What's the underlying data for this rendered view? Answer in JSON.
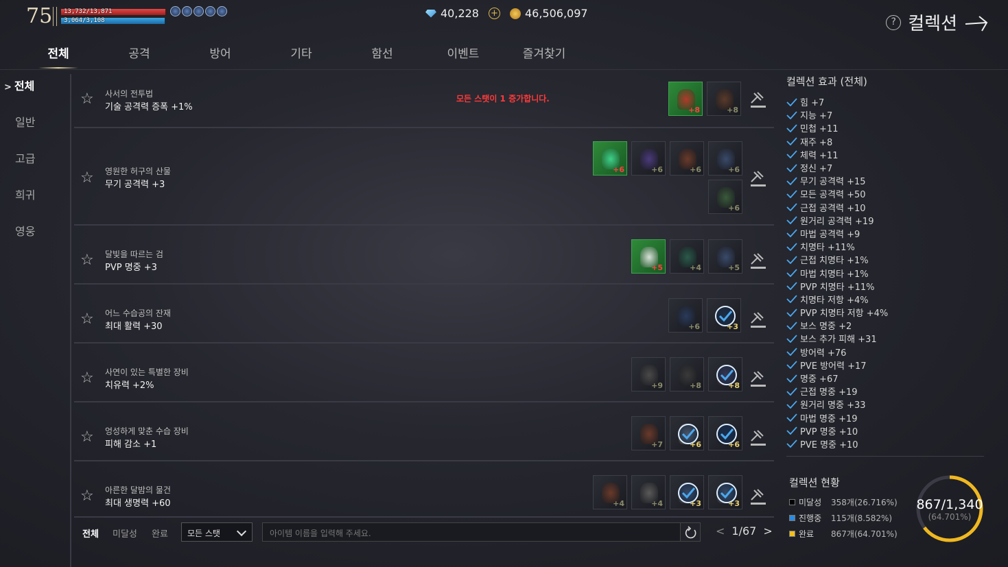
{
  "hud": {
    "level": "75",
    "hp": "13,732/13,871",
    "mp": "3,064/3,108",
    "diamonds": "40,228",
    "gold": "46,506,097"
  },
  "header": {
    "title": "컬렉션",
    "help": "?"
  },
  "tabs": [
    "전체",
    "공격",
    "방어",
    "기타",
    "함선",
    "이벤트",
    "즐겨찾기"
  ],
  "sidebar": {
    "chevron": ">",
    "items": [
      "전체",
      "일반",
      "고급",
      "희귀",
      "영웅"
    ]
  },
  "notice": "모든 스탯이 1 증가합니다.",
  "collections": [
    {
      "name": "사서의 전투법",
      "effect": "기술 공격력 증폭 +1%",
      "items": [
        {
          "enh": "+8",
          "owned": true,
          "color": "#b03a2a",
          "check": false
        },
        {
          "enh": "+8",
          "owned": false,
          "color": "#5a3a2a",
          "check": false
        }
      ]
    },
    {
      "name": "영원한 허구의 산물",
      "effect": "무기 공격력 +3",
      "items": [
        {
          "enh": "+6",
          "owned": true,
          "color": "#3fd08a",
          "check": false
        },
        {
          "enh": "+6",
          "owned": false,
          "color": "#4a3a7a",
          "check": false
        },
        {
          "enh": "+6",
          "owned": false,
          "color": "#6a3a2a",
          "check": false
        },
        {
          "enh": "+6",
          "owned": false,
          "color": "#3a4a6a",
          "check": false
        },
        {
          "enh": "+6",
          "owned": false,
          "color": "#3a5a3a",
          "check": false
        }
      ]
    },
    {
      "name": "달빛을 따르는 검",
      "effect": "PVP 명중 +3",
      "items": [
        {
          "enh": "+5",
          "owned": true,
          "color": "#d8e0d8",
          "check": false
        },
        {
          "enh": "+4",
          "owned": false,
          "color": "#2a5a4a",
          "check": false
        },
        {
          "enh": "+5",
          "owned": false,
          "color": "#3a4a6a",
          "check": false
        }
      ]
    },
    {
      "name": "어느 수습공의 잔재",
      "effect": "최대 활력 +30",
      "items": [
        {
          "enh": "+6",
          "owned": false,
          "color": "#2a3a5a",
          "check": false
        },
        {
          "enh": "+3",
          "owned": false,
          "color": "#3a3a3a",
          "check": true
        }
      ]
    },
    {
      "name": "사연이 있는 특별한 장비",
      "effect": "치유력 +2%",
      "items": [
        {
          "enh": "+9",
          "owned": false,
          "color": "#4a4a4a",
          "check": false
        },
        {
          "enh": "+8",
          "owned": false,
          "color": "#3a3a3a",
          "check": false
        },
        {
          "enh": "+8",
          "owned": false,
          "color": "#8a5a6a",
          "check": true
        }
      ]
    },
    {
      "name": "엉성하게 맞춘 수습 장비",
      "effect": "피해 감소 +1",
      "items": [
        {
          "enh": "+7",
          "owned": false,
          "color": "#6a3a2a",
          "check": false
        },
        {
          "enh": "+6",
          "owned": false,
          "color": "#c8c0b0",
          "check": true
        },
        {
          "enh": "+6",
          "owned": false,
          "color": "#2a3a5a",
          "check": true
        }
      ]
    },
    {
      "name": "아른한 달밤의 물건",
      "effect": "최대 생명력 +60",
      "items": [
        {
          "enh": "+4",
          "owned": false,
          "color": "#6a3a2a",
          "check": false
        },
        {
          "enh": "+4",
          "owned": false,
          "color": "#5a5a5a",
          "check": false
        },
        {
          "enh": "+3",
          "owned": false,
          "color": "#8a9ab0",
          "check": true
        },
        {
          "enh": "+3",
          "owned": false,
          "color": "#8a9ab0",
          "check": true
        }
      ]
    }
  ],
  "bottom": {
    "filters": [
      "전체",
      "미달성",
      "완료"
    ],
    "select": "모든 스탯",
    "search_placeholder": "아이템 이름을 입력해 주세요.",
    "page": "1/67",
    "prev": "<",
    "next": ">"
  },
  "effects": {
    "title": "컬렉션 효과 (전체)",
    "stats": [
      "힘 +7",
      "지능 +7",
      "민첩 +11",
      "재주 +8",
      "체력 +11",
      "정신 +7",
      "무기 공격력 +15",
      "모든 공격력 +50",
      "근접 공격력 +10",
      "원거리 공격력 +19",
      "마법 공격력 +9",
      "치명타 +11%",
      "근접 치명타 +1%",
      "마법 치명타 +1%",
      "PVP 치명타 +11%",
      "치명타 저항 +4%",
      "PVP 치명타 저항 +4%",
      "보스 명중 +2",
      "보스 추가 피해 +31",
      "방어력 +76",
      "PVE 방어력 +17",
      "명중 +67",
      "근접 명중 +19",
      "원거리 명중 +33",
      "마법 명중 +19",
      "PVP 명중 +10",
      "PVE 명중 +10"
    ]
  },
  "status": {
    "title": "컬렉션 현황",
    "rows": [
      {
        "label": "미달성",
        "value": "358개(26.716%)",
        "color": "#000000"
      },
      {
        "label": "진행중",
        "value": "115개(8.582%)",
        "color": "#2a8ae0"
      },
      {
        "label": "완료",
        "value": "867개(64.701%)",
        "color": "#f0c020"
      }
    ],
    "total": "867/1,340",
    "percent": "(64.701%)",
    "fraction": 0.64701,
    "accent": "#f0b820"
  },
  "colors": {
    "check": "#4aa8f0",
    "notice": "#ff3a3a"
  }
}
